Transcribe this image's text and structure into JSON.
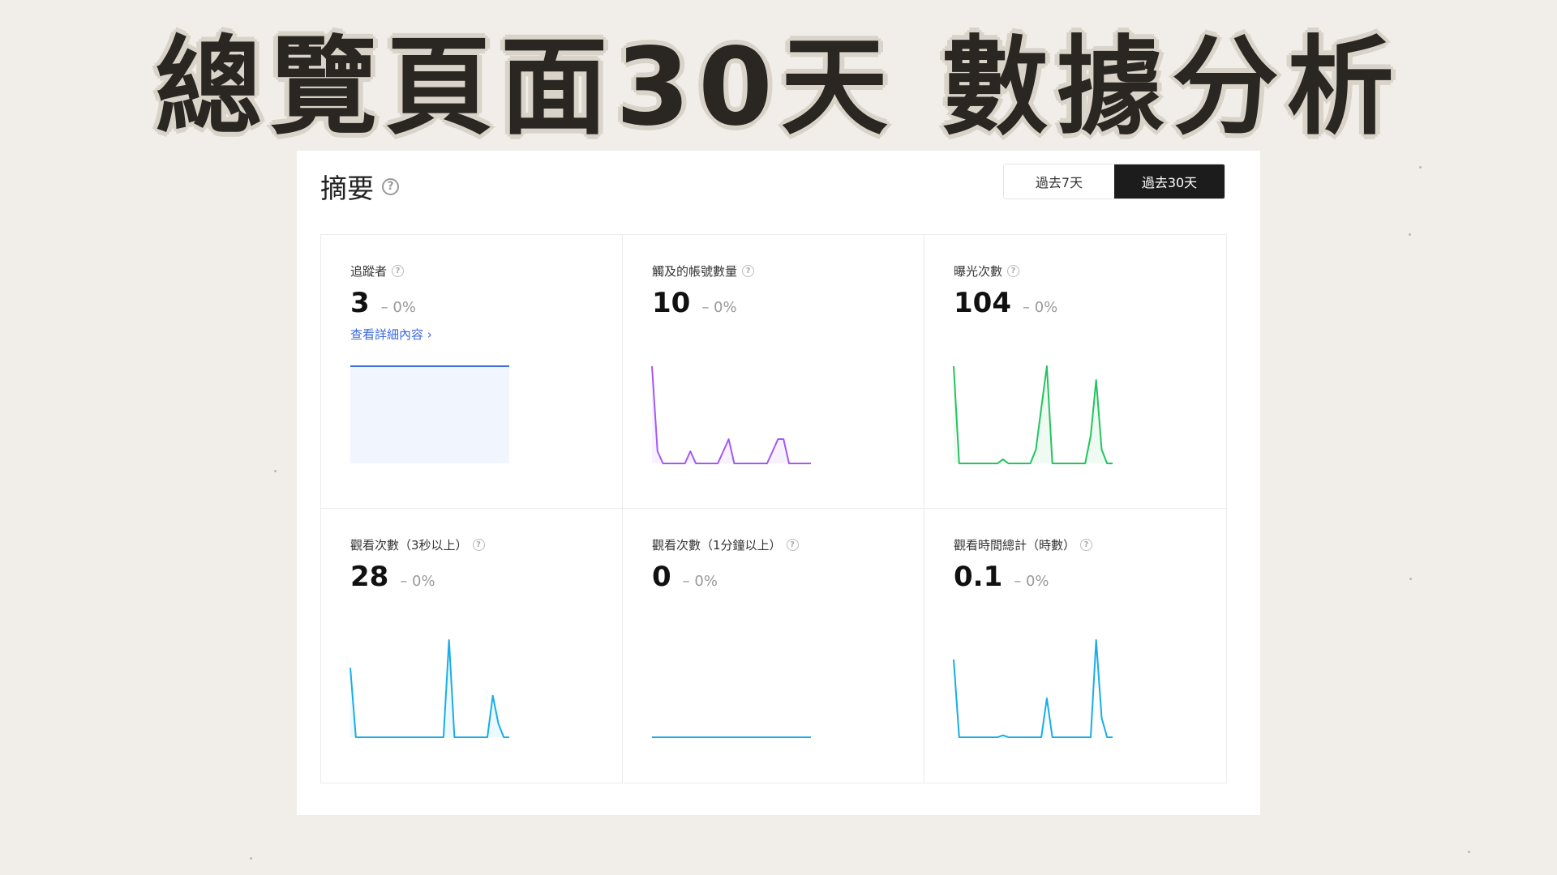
{
  "headline": "總覽頁面30天  數據分析",
  "summary": {
    "title": "摘要",
    "help_glyph": "?"
  },
  "range_toggle": {
    "options": [
      "過去7天",
      "過去30天"
    ],
    "selected": "過去30天"
  },
  "cards": [
    {
      "label": "追蹤者",
      "value": "3",
      "change": "– 0%",
      "link": "查看詳細內容 ›",
      "color": "#3b6ee8",
      "series": [
        1,
        1,
        1,
        1,
        1,
        1,
        1,
        1,
        1,
        1,
        1,
        1,
        1,
        1,
        1,
        1,
        1,
        1,
        1,
        1,
        1,
        1,
        1,
        1,
        1,
        1,
        1,
        1,
        1,
        1
      ],
      "fill": true
    },
    {
      "label": "觸及的帳號數量",
      "value": "10",
      "change": "– 0%",
      "color": "#a259f5",
      "series": [
        8,
        1,
        0,
        0,
        0,
        0,
        0,
        1,
        0,
        0,
        0,
        0,
        0,
        1,
        2,
        0,
        0,
        0,
        0,
        0,
        0,
        0,
        1,
        2,
        2,
        0,
        0,
        0,
        0,
        0
      ],
      "fill": true
    },
    {
      "label": "曝光次數",
      "value": "104",
      "change": "– 0%",
      "color": "#22c55e",
      "series": [
        7,
        0,
        0,
        0,
        0,
        0,
        0,
        0,
        0,
        0.3,
        0,
        0,
        0,
        0,
        0,
        1,
        4,
        7,
        0,
        0,
        0,
        0,
        0,
        0,
        0,
        2,
        6,
        1,
        0,
        0
      ],
      "fill": true
    },
    {
      "label": "觀看次數（3秒以上）",
      "value": "28",
      "change": "– 0%",
      "color": "#16aee8",
      "series": [
        5,
        0,
        0,
        0,
        0,
        0,
        0,
        0,
        0,
        0,
        0,
        0,
        0,
        0,
        0,
        0,
        0,
        0,
        7,
        0,
        0,
        0,
        0,
        0,
        0,
        0,
        3,
        1,
        0,
        0
      ],
      "fill": true
    },
    {
      "label": "觀看次數（1分鐘以上）",
      "value": "0",
      "change": "– 0%",
      "color": "#16aee8",
      "series": [
        0,
        0,
        0,
        0,
        0,
        0,
        0,
        0,
        0,
        0,
        0,
        0,
        0,
        0,
        0,
        0,
        0,
        0,
        0,
        0,
        0,
        0,
        0,
        0,
        0,
        0,
        0,
        0,
        0,
        0
      ],
      "fill": false
    },
    {
      "label": "觀看時間總計（時數）",
      "value": "0.1",
      "change": "– 0%",
      "color": "#16aee8",
      "series": [
        4,
        0,
        0,
        0,
        0,
        0,
        0,
        0,
        0,
        0.1,
        0,
        0,
        0,
        0,
        0,
        0,
        0,
        2,
        0,
        0,
        0,
        0,
        0,
        0,
        0,
        0,
        5,
        1,
        0,
        0
      ],
      "fill": false
    }
  ]
}
